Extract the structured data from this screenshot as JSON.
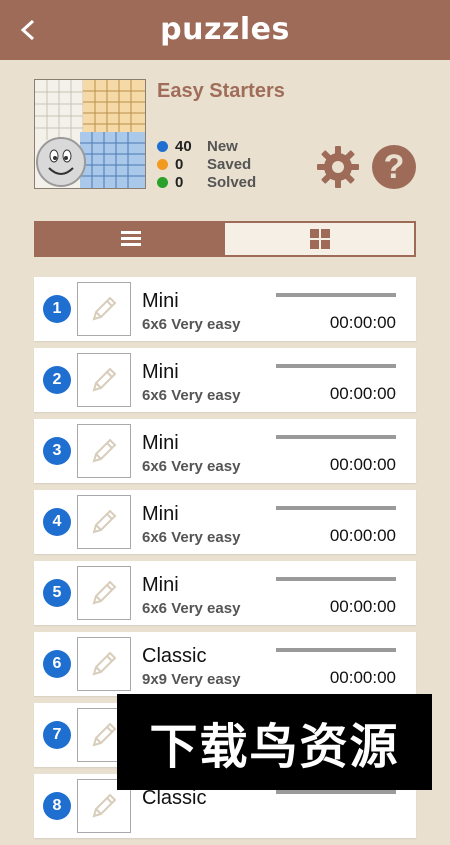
{
  "app": {
    "title": "puzzles",
    "accent": "#9e6b58",
    "badge_color": "#1f6fd0"
  },
  "pack": {
    "title": "Easy Starters",
    "stats": [
      {
        "count": "40",
        "label": "New",
        "color": "#1f6fd0"
      },
      {
        "count": "0",
        "label": "Saved",
        "color": "#f29a1f"
      },
      {
        "count": "0",
        "label": "Solved",
        "color": "#2aa12a"
      }
    ]
  },
  "toolbar": {
    "settings_icon": "gear-icon",
    "help_label": "?"
  },
  "view_toggle": {
    "active": "list",
    "options": [
      "list-icon",
      "grid-icon"
    ]
  },
  "puzzles": [
    {
      "num": "1",
      "title": "Mini",
      "sub": "6x6 Very easy",
      "time": "00:00:00"
    },
    {
      "num": "2",
      "title": "Mini",
      "sub": "6x6 Very easy",
      "time": "00:00:00"
    },
    {
      "num": "3",
      "title": "Mini",
      "sub": "6x6 Very easy",
      "time": "00:00:00"
    },
    {
      "num": "4",
      "title": "Mini",
      "sub": "6x6 Very easy",
      "time": "00:00:00"
    },
    {
      "num": "5",
      "title": "Mini",
      "sub": "6x6 Very easy",
      "time": "00:00:00"
    },
    {
      "num": "6",
      "title": "Classic",
      "sub": "9x9 Very easy",
      "time": "00:00:00"
    },
    {
      "num": "7",
      "title": "",
      "sub": "",
      "time": ""
    },
    {
      "num": "8",
      "title": "Classic",
      "sub": "",
      "time": ""
    }
  ],
  "watermark": {
    "text": "下载鸟资源"
  }
}
